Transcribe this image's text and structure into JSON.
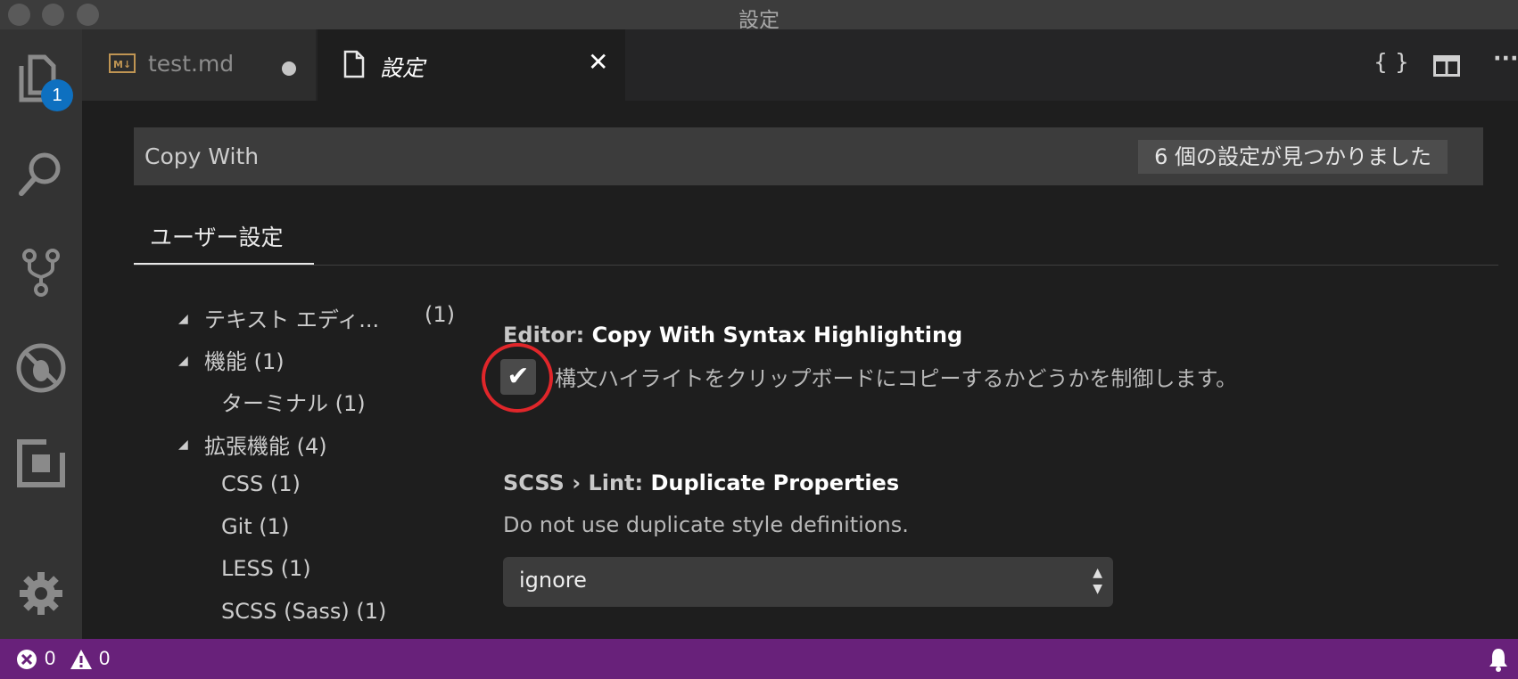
{
  "window": {
    "title": "設定"
  },
  "activity_bar": {
    "explorer_badge": "1"
  },
  "tabs": [
    {
      "label": "test.md",
      "icon": "markdown-icon",
      "dirty": true
    },
    {
      "label": "設定",
      "icon": "file-icon",
      "active": true
    }
  ],
  "toolbar": {
    "braces": "{ }",
    "more": "···"
  },
  "search": {
    "value": "Copy With",
    "result_count": "6 個の設定が見つかりました"
  },
  "scope_tab": "ユーザー設定",
  "toc": {
    "items": [
      {
        "label": "テキスト エディ...",
        "count": "(1)",
        "expanded": true,
        "level": 0
      },
      {
        "label": "機能 (1)",
        "expanded": true,
        "level": 0
      },
      {
        "label": "ターミナル (1)",
        "level": 1
      },
      {
        "label": "拡張機能 (4)",
        "expanded": true,
        "level": 0
      },
      {
        "label": "CSS (1)",
        "level": 1
      },
      {
        "label": "Git (1)",
        "level": 1
      },
      {
        "label": "LESS (1)",
        "level": 1
      },
      {
        "label": "SCSS (Sass) (1)",
        "level": 1
      }
    ]
  },
  "settings": [
    {
      "category": "Editor: ",
      "name": "Copy With Syntax Highlighting",
      "description": "構文ハイライトをクリップボードにコピーするかどうかを制御します。",
      "checkbox_mark": "✔",
      "checked": true
    },
    {
      "category": "SCSS › Lint: ",
      "name": "Duplicate Properties",
      "description": "Do not use duplicate style definitions.",
      "value": "ignore"
    }
  ],
  "status": {
    "errors": "0",
    "warnings": "0"
  },
  "colors": {
    "status_bar": "#68217a",
    "badge": "#0e70c0",
    "highlight_circle": "#e0262a"
  }
}
